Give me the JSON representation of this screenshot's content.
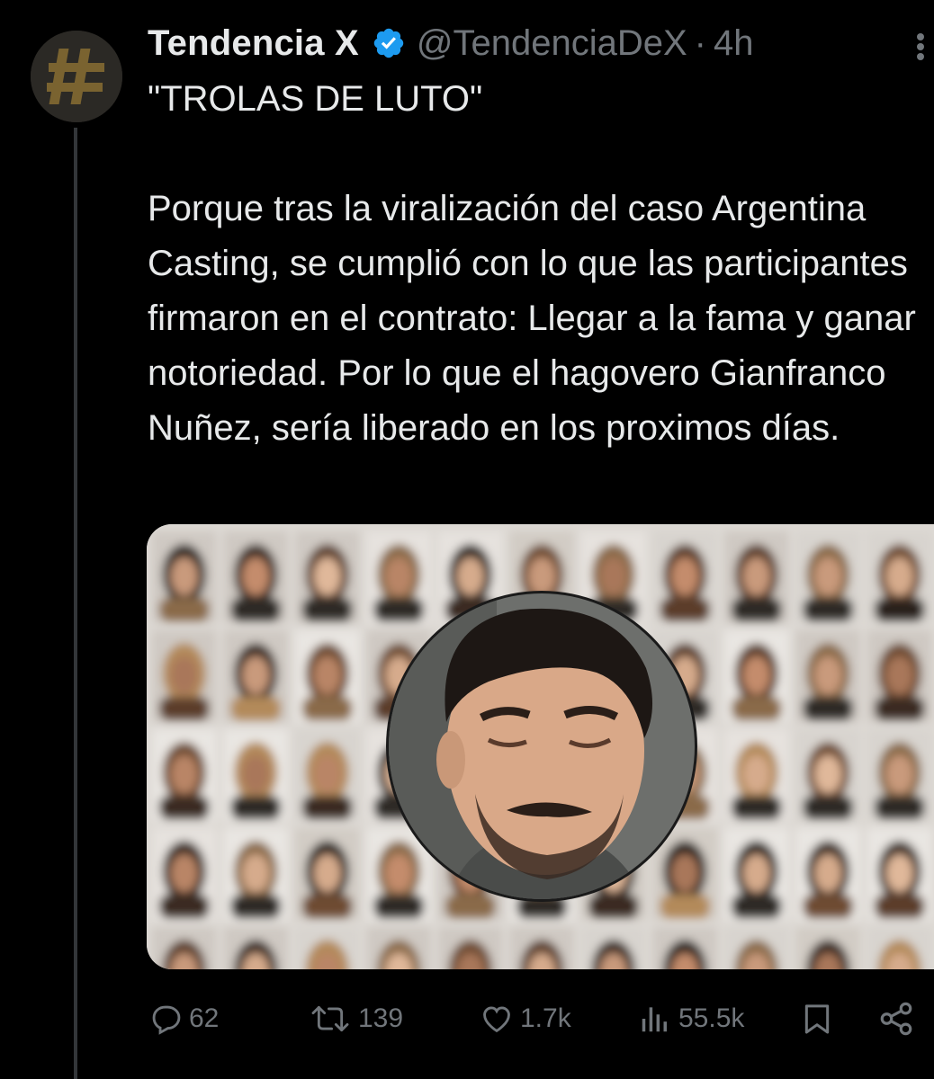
{
  "author": {
    "display_name": "Tendencia X",
    "handle": "@TendenciaDeX",
    "separator": "·",
    "time": "4h",
    "verified": true,
    "avatar_icon": "hashtag-icon",
    "avatar_color": "#7a6330"
  },
  "tweet": {
    "text": "\"TROLAS DE LUTO\"\n\nPorque tras la viralización del caso Argentina Casting, se cumplió con lo que las participantes firmaron en el contrato: Llegar a la fama y ganar notoriedad. Por lo que el hagovero Gianfranco Nuñez, sería liberado en los proximos días."
  },
  "actions": {
    "replies": "62",
    "retweets": "139",
    "likes": "1.7k",
    "views": "55.5k"
  },
  "colors": {
    "background": "#000000",
    "text": "#e7e9ea",
    "muted": "#71767b",
    "verified": "#1d9bf0"
  }
}
